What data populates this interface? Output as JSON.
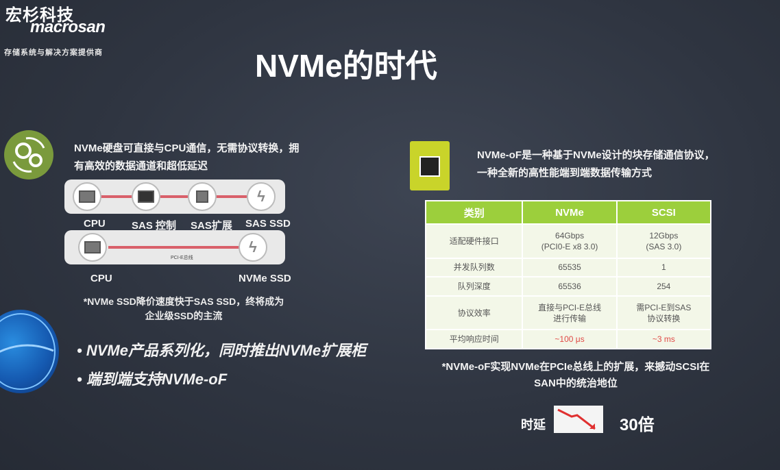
{
  "logo": {
    "cn": "宏杉科技",
    "brand": "macrosan",
    "tagline": "存储系统与解决方案提供商"
  },
  "title": "NVMe的时代",
  "left": {
    "intro": "NVMe硬盘可直接与CPU通信，无需协议转换，拥有高效的数据通道和超低延迟",
    "path1_labels": [
      "CPU",
      "SAS 控制",
      "SAS扩展",
      "SAS SSD"
    ],
    "path2_labels": [
      "CPU",
      "NVMe SSD"
    ],
    "pcie_label": "PCI-E总线",
    "note": "*NVMe SSD降价速度快于SAS SSD，终将成为企业级SSD的主流",
    "bullets": [
      "NVMe产品系列化，同时推出NVMe扩展柜",
      "端到端支持NVMe-oF"
    ]
  },
  "right": {
    "intro": "NVMe-oF是一种基于NVMe设计的块存储通信协议，一种全新的高性能端到端数据传输方式",
    "table": {
      "headers": [
        "类别",
        "NVMe",
        "SCSI"
      ],
      "rows": [
        [
          "适配硬件接口",
          "64Gbps\n(PCI0-E x8 3.0)",
          "12Gbps\n(SAS 3.0)"
        ],
        [
          "并发队列数",
          "65535",
          "1"
        ],
        [
          "队列深度",
          "65536",
          "254"
        ],
        [
          "协议效率",
          "直接与PCI-E总线\n进行传输",
          "需PCI-E到SAS\n协议转换"
        ],
        [
          "平均响应时间",
          "~100 μs",
          "~3 ms"
        ]
      ]
    },
    "note": "*NVMe-oF实现NVMe在PCIe总线上的扩展，来撼动SCSI在SAN中的统治地位",
    "latency_label": "时延",
    "latency_value": "30倍"
  },
  "colors": {
    "accent_green": "#9ccf3c",
    "accent_red": "#d9606a",
    "icon_yellow": "#c9d42a"
  }
}
